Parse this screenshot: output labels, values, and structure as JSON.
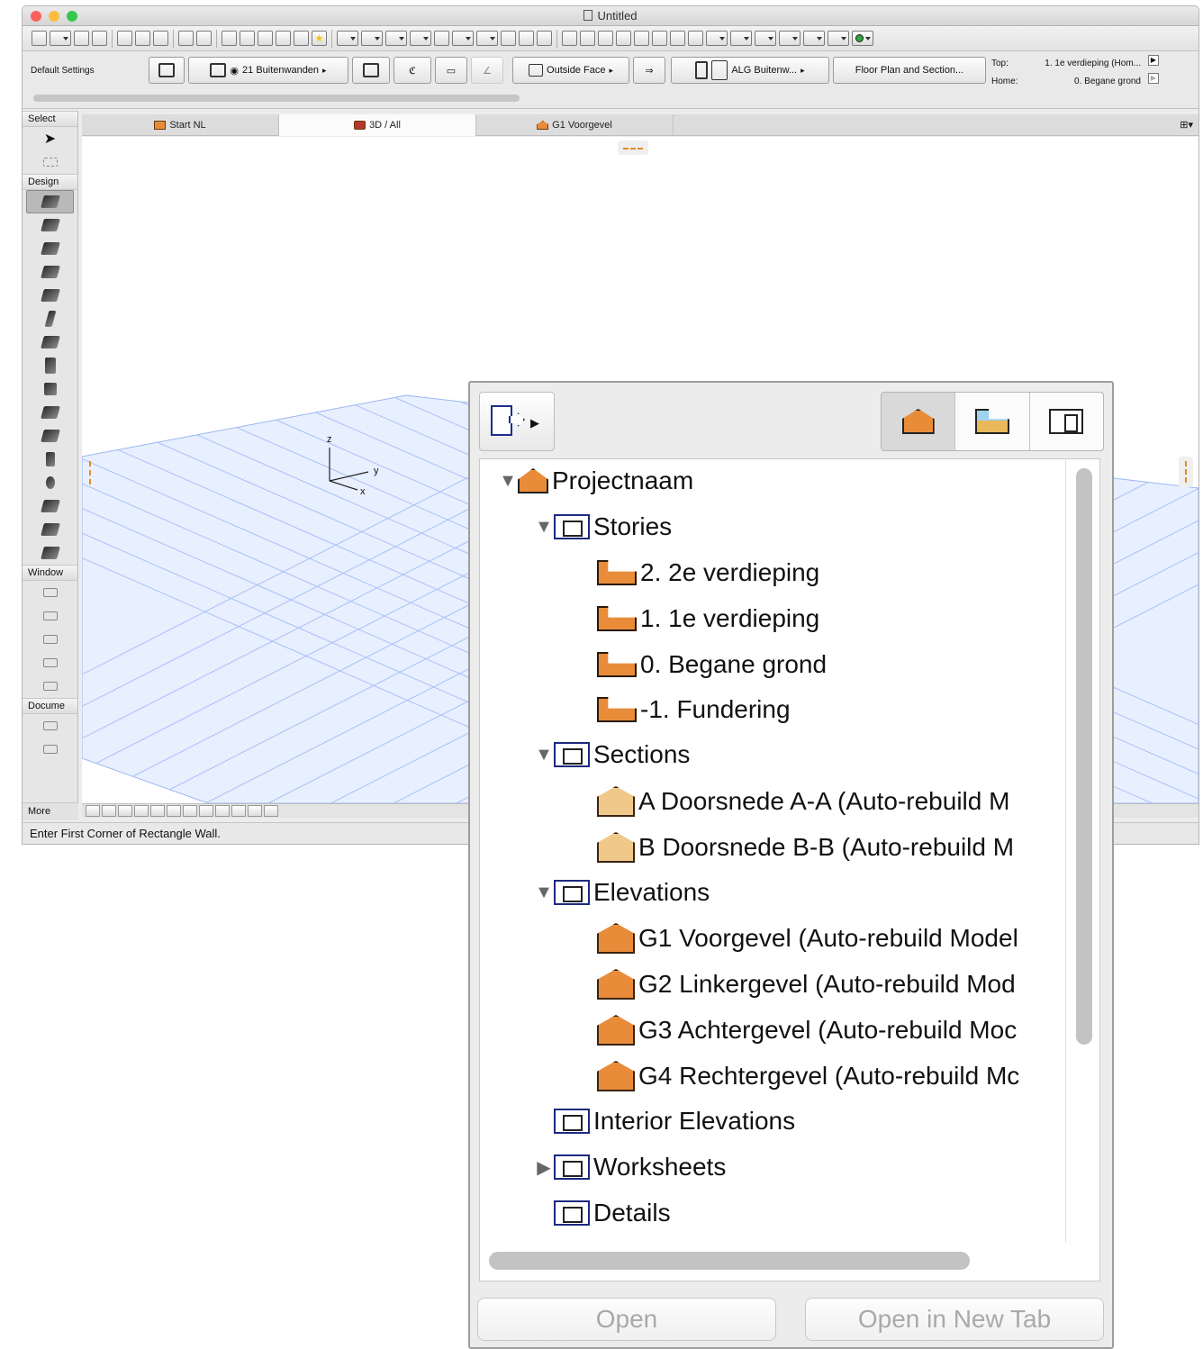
{
  "window": {
    "title": "Untitled",
    "traffic_lights": [
      "#fc605c",
      "#fdbc40",
      "#34c84a"
    ]
  },
  "info_box": {
    "default_settings": "Default Settings",
    "layer": "21 Buitenwanden",
    "reference_line": "Outside Face",
    "composite": "ALG Buitenw...",
    "display": "Floor Plan and Section...",
    "top_label": "Top:",
    "top_value": "1. 1e verdieping (Hom...",
    "home_label": "Home:",
    "home_value": "0. Begane grond"
  },
  "toolbox": {
    "select": "Select",
    "design": "Design",
    "window": "Window",
    "document": "Docume",
    "more": "More"
  },
  "tabs": [
    {
      "label": "Start NL",
      "active": false
    },
    {
      "label": "3D / All",
      "active": true
    },
    {
      "label": "G1 Voorgevel",
      "active": false
    }
  ],
  "viewport": {
    "axis_x": "x",
    "axis_y": "y",
    "axis_z": "z"
  },
  "status": "Enter First Corner of Rectangle Wall.",
  "navigator": {
    "tree": [
      {
        "label": "Projectnaam",
        "level": 0,
        "icon": "project-icon",
        "expanded": true
      },
      {
        "label": "Stories",
        "level": 1,
        "icon": "stories-folder-icon",
        "expanded": true
      },
      {
        "label": "2. 2e verdieping",
        "level": 2,
        "icon": "story-icon"
      },
      {
        "label": "1. 1e verdieping",
        "level": 2,
        "icon": "story-icon"
      },
      {
        "label": "0. Begane grond",
        "level": 2,
        "icon": "story-icon"
      },
      {
        "label": "-1. Fundering",
        "level": 2,
        "icon": "story-icon"
      },
      {
        "label": "Sections",
        "level": 1,
        "icon": "sections-folder-icon",
        "expanded": true
      },
      {
        "label": "A Doorsnede A-A (Auto-rebuild M",
        "level": 2,
        "icon": "section-icon"
      },
      {
        "label": "B Doorsnede B-B (Auto-rebuild M",
        "level": 2,
        "icon": "section-icon"
      },
      {
        "label": "Elevations",
        "level": 1,
        "icon": "elevations-folder-icon",
        "expanded": true
      },
      {
        "label": "G1 Voorgevel (Auto-rebuild Model",
        "level": 2,
        "icon": "elevation-icon"
      },
      {
        "label": "G2 Linkergevel (Auto-rebuild Mod",
        "level": 2,
        "icon": "elevation-icon"
      },
      {
        "label": "G3 Achtergevel (Auto-rebuild Moc",
        "level": 2,
        "icon": "elevation-icon"
      },
      {
        "label": "G4 Rechtergevel (Auto-rebuild Mc",
        "level": 2,
        "icon": "elevation-icon"
      },
      {
        "label": "Interior Elevations",
        "level": 1,
        "icon": "interior-elevations-icon"
      },
      {
        "label": "Worksheets",
        "level": 1,
        "icon": "worksheets-icon",
        "expanded": false
      },
      {
        "label": "Details",
        "level": 1,
        "icon": "details-icon"
      }
    ],
    "open_button": "Open",
    "open_new_tab_button": "Open in New Tab"
  }
}
